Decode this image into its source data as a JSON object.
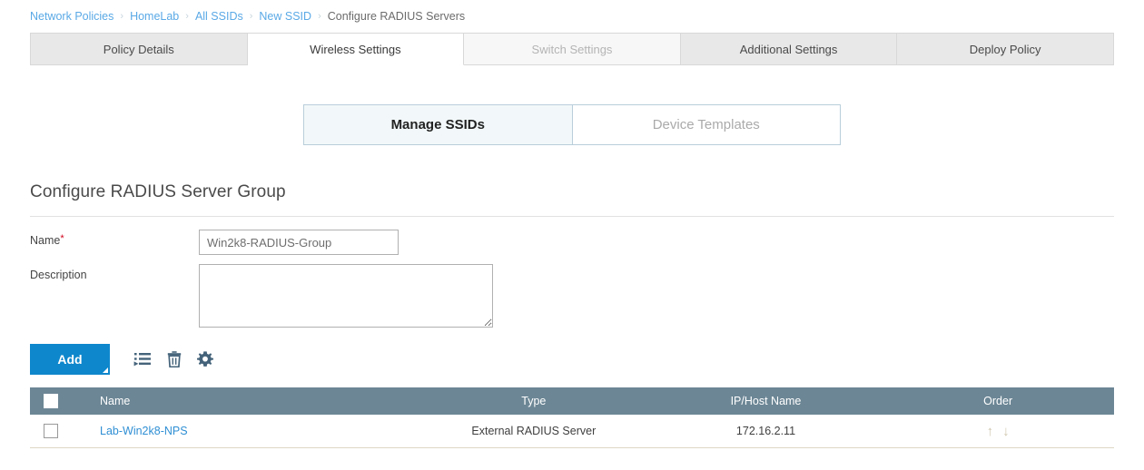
{
  "breadcrumb": {
    "separator": "›",
    "items": [
      {
        "label": "Network Policies",
        "current": false
      },
      {
        "label": "HomeLab",
        "current": false
      },
      {
        "label": "All SSIDs",
        "current": false
      },
      {
        "label": "New SSID",
        "current": false
      },
      {
        "label": "Configure RADIUS Servers",
        "current": true
      }
    ]
  },
  "tabs": [
    {
      "label": "Policy Details",
      "state": "normal"
    },
    {
      "label": "Wireless Settings",
      "state": "active"
    },
    {
      "label": "Switch Settings",
      "state": "disabled"
    },
    {
      "label": "Additional Settings",
      "state": "normal"
    },
    {
      "label": "Deploy Policy",
      "state": "normal"
    }
  ],
  "subtoggle": [
    {
      "label": "Manage SSIDs",
      "state": "active"
    },
    {
      "label": "Device Templates",
      "state": "inactive"
    }
  ],
  "section": {
    "title": "Configure RADIUS Server Group"
  },
  "form": {
    "name_label": "Name",
    "name_required_mark": "*",
    "name_value": "Win2k8-RADIUS-Group",
    "name_placeholder": "",
    "description_label": "Description",
    "description_value": "",
    "description_placeholder": ""
  },
  "toolbar": {
    "add_label": "Add",
    "icons": [
      {
        "name": "list-insert-icon",
        "title": "Insert"
      },
      {
        "name": "trash-icon",
        "title": "Delete"
      },
      {
        "name": "gear-icon",
        "title": "Settings"
      }
    ]
  },
  "table": {
    "select_all_checkbox": "",
    "columns": [
      "Name",
      "Type",
      "IP/Host Name",
      "Order"
    ],
    "rows": [
      {
        "name": "Lab-Win2k8-NPS",
        "type": "External RADIUS Server",
        "ip_host": "172.16.2.11",
        "order_up": "↑",
        "order_down": "↓"
      }
    ]
  },
  "colors": {
    "accent_blue": "#0e87cc",
    "link_blue": "#2f8fd4",
    "breadcrumb_blue": "#5aa9e6",
    "table_header": "#6c8695",
    "row_border": "#ddd6c4",
    "required_red": "#d0021b",
    "toggle_active_bg": "#f2f8f9"
  }
}
